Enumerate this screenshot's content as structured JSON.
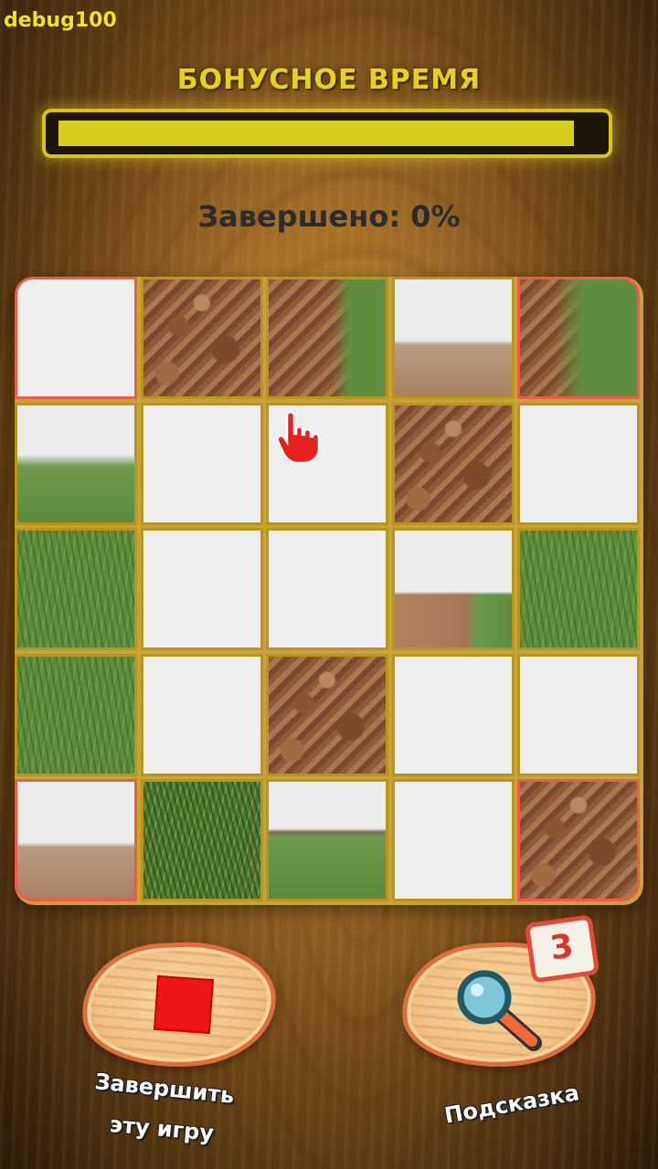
{
  "debug_label": "debug100",
  "bonus": {
    "title": "БОНУСНОЕ ВРЕМЯ",
    "fill_fraction": 0.96
  },
  "progress": {
    "text": "Завершено: 0%",
    "percent": 0
  },
  "board": {
    "rows": 5,
    "cols": 5,
    "tiles": [
      [
        "sky",
        "soil",
        "soil-grass",
        "horizon-soil",
        "soil-grass-b"
      ],
      [
        "horizon-grass",
        "sky",
        "sky",
        "soil",
        "sky"
      ],
      [
        "grass",
        "sky",
        "sky",
        "horizon-mixed",
        "grass"
      ],
      [
        "grass",
        "sky",
        "soil",
        "sky",
        "sky"
      ],
      [
        "horizon-soil",
        "grass-thick",
        "horizon-grass-low",
        "sky",
        "soil"
      ]
    ]
  },
  "buttons": {
    "stop": {
      "label_line1": "Завершить",
      "label_line2": "эту игру",
      "icon": "stop-square-icon"
    },
    "hint": {
      "label": "Подсказка",
      "count": "3",
      "icon": "magnifier-icon"
    }
  },
  "colors": {
    "accent": "#e6d21a",
    "tile_border": "#b8961e",
    "corner_border": "#ef5a4a",
    "stop_red": "#ee1616"
  }
}
